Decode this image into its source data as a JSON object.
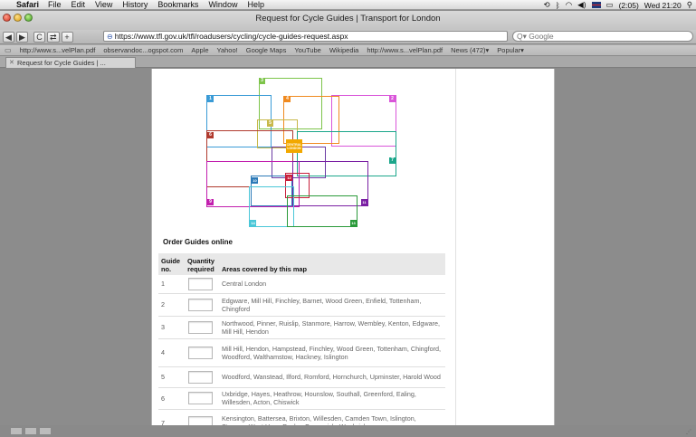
{
  "menubar": {
    "app_name": "Safari",
    "menus": [
      "File",
      "Edit",
      "View",
      "History",
      "Bookmarks",
      "Window",
      "Help"
    ],
    "battery": "(2:05)",
    "clock": "Wed 21:20"
  },
  "window": {
    "title": "Request for Cycle Guides | Transport for London"
  },
  "toolbar": {
    "back_label": "◀",
    "forward_label": "▶",
    "reload_label": "C",
    "url": "https://www.tfl.gov.uk/tfl/roadusers/cycling/cycle-guides-request.aspx",
    "search_placeholder": "Q▾ Google",
    "add_label": "+"
  },
  "bookmarks": [
    "http://www.s...velPlan.pdf",
    "observandoc...ogspot.com",
    "Apple",
    "Yahoo!",
    "Google Maps",
    "YouTube",
    "Wikipedia",
    "http://www.s...velPlan.pdf",
    "News (472)▾",
    "Popular▾"
  ],
  "tab": {
    "label": "Request for Cycle Guides | ..."
  },
  "map": {
    "zones": [
      {
        "num": "1",
        "color": "#3a9bd6"
      },
      {
        "num": "2",
        "color": "#d955d9"
      },
      {
        "num": "3",
        "color": "#7dc44a"
      },
      {
        "num": "4",
        "color": "#f08a1f"
      },
      {
        "num": "5",
        "color": "#c8b84a"
      },
      {
        "num": "6",
        "color": "#b03a2e"
      },
      {
        "num": "7",
        "color": "#6a3aa3"
      },
      {
        "num": "8",
        "color": "#1aa68a"
      },
      {
        "num": "9",
        "color": "#c21fae"
      },
      {
        "num": "10",
        "color": "#2c7ab8"
      },
      {
        "num": "11",
        "color": "#7a1fa3"
      },
      {
        "num": "12",
        "color": "#c81f3a"
      },
      {
        "num": "13",
        "color": "#2a9a3a"
      },
      {
        "num": "14",
        "color": "#4ac7d8"
      }
    ],
    "central_label_1": "CENTRAL",
    "central_label_2": "LONDON"
  },
  "order_title": "Order Guides online",
  "table": {
    "headers": {
      "guide_no": "Guide no.",
      "quantity": "Quantity required",
      "areas": "Areas covered by this map"
    },
    "rows": [
      {
        "no": "1",
        "areas": "Central London"
      },
      {
        "no": "2",
        "areas": "Edgware, Mill Hill, Finchley, Barnet, Wood Green, Enfield, Tottenham, Chingford"
      },
      {
        "no": "3",
        "areas": "Northwood, Pinner, Ruislip, Stanmore, Harrow, Wembley, Kenton, Edgware, Mill Hill, Hendon"
      },
      {
        "no": "4",
        "areas": "Mill Hill, Hendon, Hampstead, Finchley, Wood Green, Tottenham, Chingford, Woodford, Walthamstow, Hackney, Islington"
      },
      {
        "no": "5",
        "areas": "Woodford, Wanstead, Ilford, Romford, Hornchurch, Upminster, Harold Wood"
      },
      {
        "no": "6",
        "areas": "Uxbridge, Hayes, Heathrow, Hounslow, Southall, Greenford, Ealing, Willesden, Acton, Chiswick"
      },
      {
        "no": "7",
        "areas": "Kensington, Battersea, Brixton, Willesden, Camden Town, Islington, Stepney, West Ham, Poplar, Greenwich, Woolwich"
      }
    ]
  }
}
